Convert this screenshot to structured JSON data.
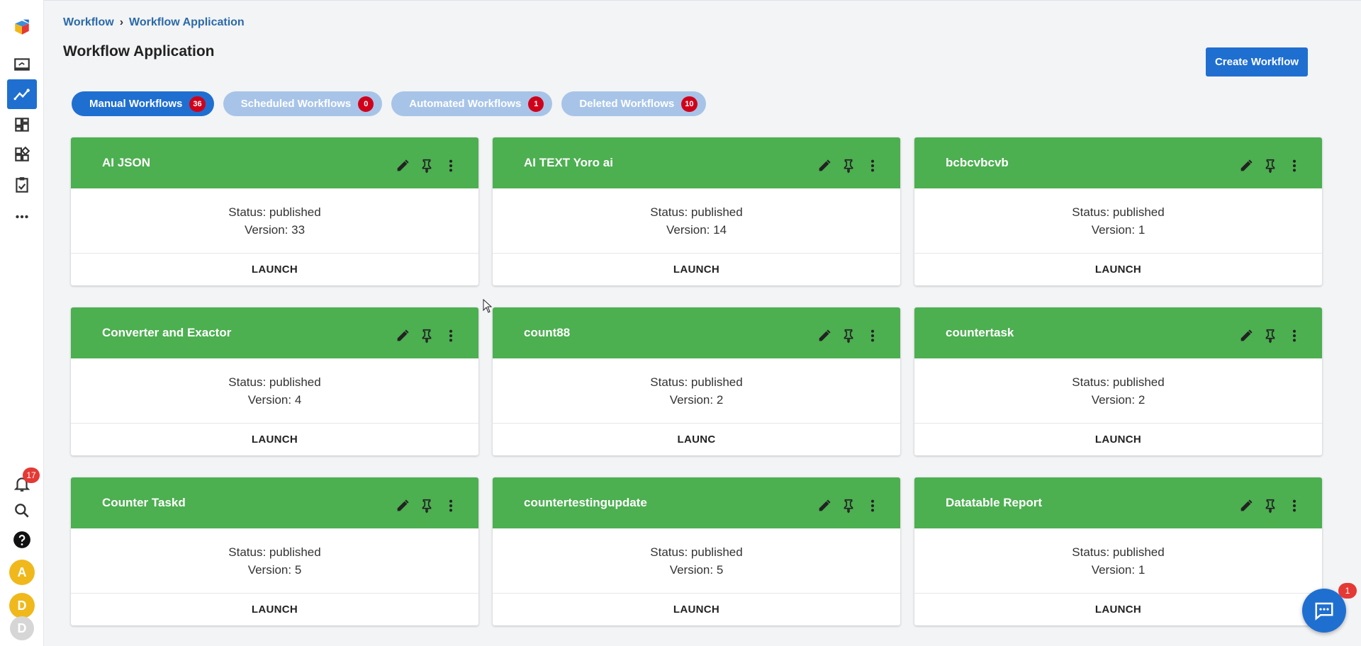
{
  "sidebar": {
    "notifications_count": "17",
    "avatars": [
      "A",
      "D",
      "D"
    ],
    "colors": {
      "active": "#1f6fd1",
      "avatar_a": "#f0b81b",
      "avatar_d": "#f0b81b",
      "avatar_d2": "#d6d6d6"
    }
  },
  "breadcrumb": {
    "root": "Workflow",
    "current": "Workflow Application"
  },
  "page": {
    "title": "Workflow Application",
    "create_label": "Create Workflow"
  },
  "tabs": [
    {
      "label": "Manual Workflows",
      "count": "36"
    },
    {
      "label": "Scheduled Workflows",
      "count": "0"
    },
    {
      "label": "Automated Workflows",
      "count": "1"
    },
    {
      "label": "Deleted Workflows",
      "count": "10"
    }
  ],
  "cards": [
    {
      "title": "AI JSON",
      "status": "Status: published",
      "version": "Version: 33",
      "action": "LAUNCH"
    },
    {
      "title": "AI TEXT Yoro ai",
      "status": "Status: published",
      "version": "Version: 14",
      "action": "LAUNCH"
    },
    {
      "title": "bcbcvbcvb",
      "status": "Status: published",
      "version": "Version: 1",
      "action": "LAUNCH"
    },
    {
      "title": "Converter and Exactor",
      "status": "Status: published",
      "version": "Version: 4",
      "action": "LAUNCH"
    },
    {
      "title": "count88",
      "status": "Status: published",
      "version": "Version: 2",
      "action": "LAUNC"
    },
    {
      "title": "countertask",
      "status": "Status: published",
      "version": "Version: 2",
      "action": "LAUNCH"
    },
    {
      "title": "Counter Taskd",
      "status": "Status: published",
      "version": "Version: 5",
      "action": "LAUNCH"
    },
    {
      "title": "countertestingupdate",
      "status": "Status: published",
      "version": "Version: 5",
      "action": "LAUNCH"
    },
    {
      "title": "Datatable Report",
      "status": "Status: published",
      "version": "Version: 1",
      "action": "LAUNCH"
    }
  ],
  "chat": {
    "badge": "1"
  },
  "colors": {
    "primary": "#1f6fd1",
    "card_header": "#4caf50",
    "badge_red": "#d0021b",
    "inactive_tab": "#a7c4e8"
  }
}
